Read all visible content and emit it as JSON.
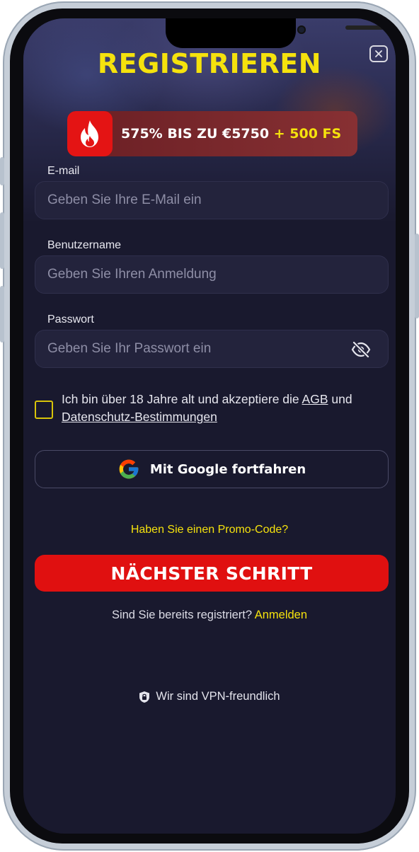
{
  "modal": {
    "title": "REGISTRIEREN",
    "close_icon": "close-icon"
  },
  "promo": {
    "icon": "fire-icon",
    "text_main": "575% BIS ZU €5750",
    "text_highlight": "+ 500 FS"
  },
  "form": {
    "email": {
      "label": "E-mail",
      "placeholder": "Geben Sie Ihre E-Mail ein",
      "value": ""
    },
    "username": {
      "label": "Benutzername",
      "placeholder": "Geben Sie Ihren Anmeldung",
      "value": ""
    },
    "password": {
      "label": "Passwort",
      "placeholder": "Geben Sie Ihr Passwort ein",
      "value": "",
      "toggle_icon": "eye-off-icon"
    }
  },
  "consent": {
    "text_before": "Ich bin über 18 Jahre alt und akzeptiere die",
    "agb_link": "AGB",
    "text_middle": "und",
    "privacy_link": "Datenschutz-Bestimmungen",
    "checked": false
  },
  "google_button": {
    "label": "Mit Google fortfahren",
    "icon": "google-icon"
  },
  "promo_code_link": "Haben Sie einen Promo-Code?",
  "next_button": "NÄCHSTER SCHRITT",
  "login_prompt": {
    "text": "Sind Sie bereits registriert?",
    "link": "Anmelden"
  },
  "vpn": {
    "icon": "shield-icon",
    "text": "Wir sind VPN-freundlich"
  },
  "colors": {
    "accent_yellow": "#f5e20d",
    "primary_red": "#e01010",
    "background": "#19192e",
    "field_bg": "#23233c"
  }
}
